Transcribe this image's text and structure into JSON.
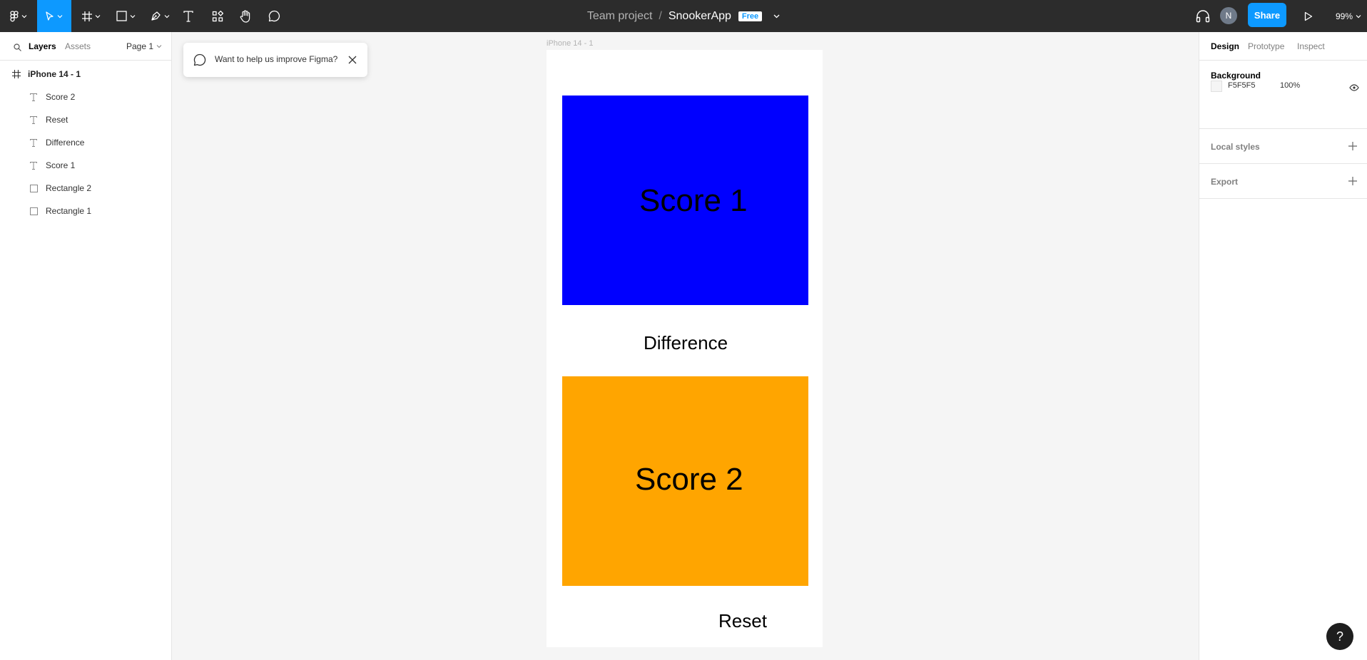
{
  "toolbar": {
    "team": "Team project",
    "separator": "/",
    "file": "SnookerApp",
    "plan_badge": "Free",
    "avatar_initial": "N",
    "share_label": "Share",
    "zoom": "99%",
    "icons": [
      "figma-menu-icon",
      "move-tool-icon",
      "frame-tool-icon",
      "rectangle-tool-icon",
      "pen-tool-icon",
      "text-tool-icon",
      "resources-icon",
      "hand-tool-icon",
      "comment-tool-icon",
      "audio-headphones-icon",
      "present-play-icon"
    ],
    "active_color": "#0d99ff"
  },
  "left_panel": {
    "tabs": [
      "Layers",
      "Assets"
    ],
    "page": "Page 1",
    "layers": [
      {
        "name": "iPhone 14 - 1",
        "type": "frame"
      },
      {
        "name": "Score 2",
        "type": "text"
      },
      {
        "name": "Reset",
        "type": "text"
      },
      {
        "name": "Difference",
        "type": "text"
      },
      {
        "name": "Score 1",
        "type": "text"
      },
      {
        "name": "Rectangle 2",
        "type": "rectangle"
      },
      {
        "name": "Rectangle 1",
        "type": "rectangle"
      }
    ]
  },
  "canvas": {
    "frame_label": "iPhone 14 - 1",
    "toast": "Want to help us improve Figma?",
    "texts": {
      "score1": "Score 1",
      "difference": "Difference",
      "score2": "Score 2",
      "reset": "Reset"
    },
    "colors": {
      "rect1": "#0000ff",
      "rect2": "#ffa500"
    }
  },
  "right_panel": {
    "tabs": [
      "Design",
      "Prototype",
      "Inspect"
    ],
    "background_title": "Background",
    "background_hex": "F5F5F5",
    "background_opacity": "100%",
    "local_styles": "Local styles",
    "export": "Export"
  },
  "help": "?"
}
